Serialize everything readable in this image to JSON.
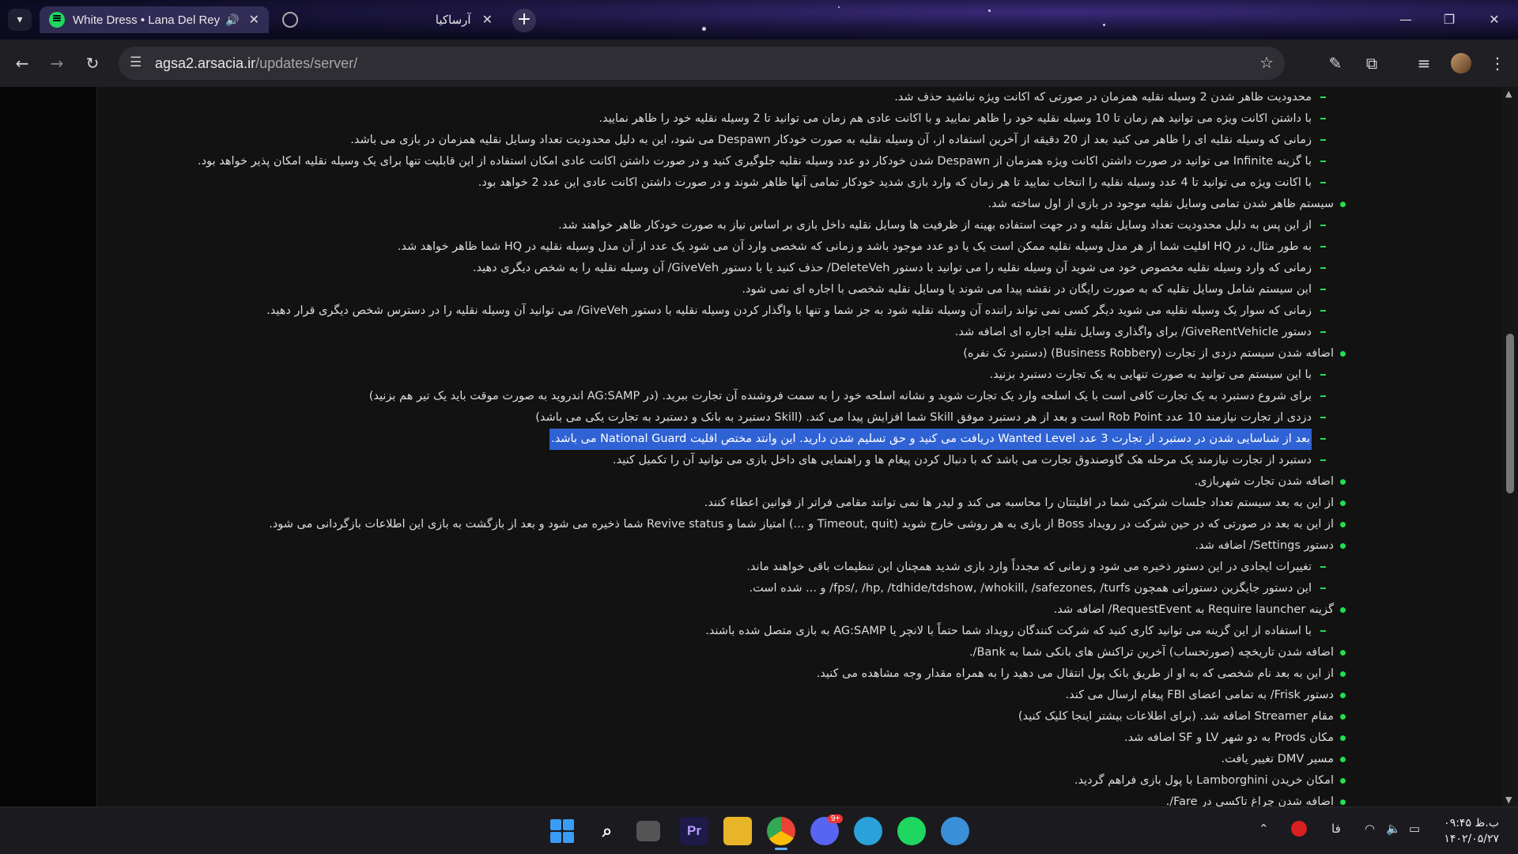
{
  "browser": {
    "tabs": [
      {
        "title": "White Dress • Lana Del Rey",
        "favicon": "spotify-icon",
        "audio": true
      },
      {
        "title": "آرساکیا",
        "favicon": "globe-icon",
        "audio": false
      }
    ],
    "url_host": "agsa2.arsacia.ir",
    "url_path": "/updates/server/"
  },
  "lines": [
    {
      "level": 1,
      "text": "محدودیت ظاهر شدن 2 وسیله نقلیه همزمان در صورتی که اکانت ویژه نباشید حذف شد."
    },
    {
      "level": 1,
      "text": "با داشتن اکانت ویژه می توانید هم زمان تا 10 وسیله نقلیه خود را ظاهر نمایید و با اکانت عادی هم زمان می توانید تا 2 وسیله نقلیه خود را ظاهر نمایید."
    },
    {
      "level": 1,
      "text": "زمانی که وسیله نقلیه ای را ظاهر می کنید بعد از 20 دقیقه از آخرین استفاده از، آن وسیله نقلیه به صورت خودکار Despawn می شود، این به دلیل محدودیت تعداد وسایل نقلیه همزمان در بازی می باشد."
    },
    {
      "level": 1,
      "text": "با گزینه Infinite می توانید در صورت داشتن اکانت ویژه همزمان از Despawn شدن خودکار دو عدد وسیله نقلیه جلوگیری کنید و در صورت داشتن اکانت عادی امکان استفاده از این قابلیت تنها برای یک وسیله نقلیه امکان پذیر خواهد بود."
    },
    {
      "level": 1,
      "text": "با اکانت ویژه می توانید تا 4 عدد وسیله نقلیه را انتخاب نمایید تا هر زمان که وارد بازی شدید خودکار تمامی آنها ظاهر شوند و در صورت داشتن اکانت عادی این عدد 2 خواهد بود."
    },
    {
      "level": 0,
      "text": "سیستم ظاهر شدن تمامی وسایل نقلیه موجود در بازی از اول ساخته شد."
    },
    {
      "level": 1,
      "text": "از این پس به دلیل محدودیت تعداد وسایل نقلیه و در جهت استفاده بهینه از ظرفیت ها وسایل نقلیه داخل بازی بر اساس نیاز به صورت خودکار ظاهر خواهند شد."
    },
    {
      "level": 1,
      "text": "به طور مثال، در HQ اقلیت شما از هر مدل وسیله نقلیه ممکن است یک یا دو عدد موجود باشد و زمانی که شخصی وارد آن می شود یک عدد از آن مدل وسیله نقلیه در HQ شما ظاهر خواهد شد."
    },
    {
      "level": 1,
      "text": "زمانی که وارد وسیله نقلیه مخصوص خود می شوید آن وسیله نقلیه را می توانید با دستور DeleteVeh/ حذف کنید یا با دستور GiveVeh/ آن وسیله نقلیه را به شخص دیگری دهید."
    },
    {
      "level": 1,
      "text": "این سیستم شامل وسایل نقلیه که به صورت رایگان در نقشه پیدا می شوند یا وسایل نقلیه شخصی با اجاره ای نمی شود."
    },
    {
      "level": 1,
      "text": "زمانی که سوار یک وسیله نقلیه می شوید دیگر کسی نمی تواند راننده آن وسیله نقلیه شود به جز شما و تنها با واگذار کردن وسیله نقلیه با دستور GiveVeh/ می توانید آن وسیله نقلیه را در دسترس شخص دیگری قرار دهید."
    },
    {
      "level": 1,
      "text": "دستور GiveRentVehicle/ برای واگذاری وسایل نقلیه اجاره ای اضافه شد."
    },
    {
      "level": 0,
      "text": "اضافه شدن سیستم دزدی از تجارت (Business Robbery) (دستبرد تک نفره)"
    },
    {
      "level": 1,
      "text": "با این سیستم می توانید به صورت تنهایی به یک تجارت دستبرد بزنید."
    },
    {
      "level": 1,
      "text": "برای شروع دستبرد به یک تجارت کافی است با یک اسلحه وارد یک تجارت شوید و نشانه اسلحه خود را به سمت فروشنده آن تجارت ببرید. (در AG:SAMP اندروید به صورت موقت باید یک تیر هم بزنید)"
    },
    {
      "level": 1,
      "text": "دزدی از تجارت نیازمند 10 عدد Rob Point است و بعد از هر دستبرد موفق Skill شما افزایش پیدا می کند. (Skill دستبرد به بانک و دستبرد به تجارت یکی می باشد)"
    },
    {
      "level": 1,
      "text": "بعد از شناسایی شدن در دستبرد از تجارت 3 عدد Wanted Level دریافت می کنید و حق تسلیم شدن دارید. این وانتد مختص اقلیت National Guard می باشد.",
      "highlighted": true
    },
    {
      "level": 1,
      "text": "دستبرد از تجارت نیازمند یک مرحله هک گاوصندوق تجارت می باشد که با دنبال کردن پیغام ها و راهنمایی های داخل بازی می توانید آن را تکمیل کنید."
    },
    {
      "level": 0,
      "text": "اضافه شدن تجارت شهربازی."
    },
    {
      "level": 0,
      "text": "از این به بعد سیستم تعداد جلسات شرکتی شما در اقلیتتان را محاسبه می کند و لیدر ها نمی توانند مقامی فراتر از قوانین اعطاء کنند."
    },
    {
      "level": 0,
      "text": "از این به بعد در صورتی که در حین شرکت در رویداد Boss از بازی به هر روشی خارج شوید (Timeout, quit و ...) امتیاز شما و Revive status شما ذخیره می شود و بعد از بازگشت به بازی این اطلاعات بازگردانی می شود."
    },
    {
      "level": 0,
      "text": "دستور Settings/ اضافه شد."
    },
    {
      "level": 1,
      "text": "تغییرات ایجادی در این دستور ذخیره می شود و زمانی که مجدداً وارد بازی شدید همچنان این تنظیمات باقی خواهند ماند."
    },
    {
      "level": 1,
      "text": "این دستور جایگزین دستوراتی همچون fps/, /hp, /tdhide/tdshow, /whokill, /safezones, /turfs/ و ... شده است."
    },
    {
      "level": 0,
      "text": "گزینه Require launcher به RequestEvent/ اضافه شد."
    },
    {
      "level": 1,
      "text": "با استفاده از این گزینه می توانید کاری کنید که شرکت کنندگان رویداد شما حتماً با لانچر یا AG:SAMP به بازی متصل شده باشند."
    },
    {
      "level": 0,
      "text": "اضافه شدن تاریخچه (صورتحساب) آخرین تراکنش های بانکی شما به Bank/."
    },
    {
      "level": 0,
      "text": "از این به بعد نام شخصی که به او از طریق بانک پول انتقال می دهید را به همراه مقدار وجه مشاهده می کنید."
    },
    {
      "level": 0,
      "text": "دستور Frisk/ به تمامی اعضای FBI پیغام ارسال می کند."
    },
    {
      "level": 0,
      "text": "مقام Streamer اضافه شد. (برای اطلاعات بیشتر اینجا کلیک کنید)"
    },
    {
      "level": 0,
      "text": "مکان Prods به دو شهر LV و SF اضافه شد."
    },
    {
      "level": 0,
      "text": "مسیر DMV تغییر یافت."
    },
    {
      "level": 0,
      "text": "امکان خریدن Lamborghini با پول بازی فراهم گردید."
    },
    {
      "level": 0,
      "text": "اضافه شدن چراغ تاکسی در Fare/."
    }
  ],
  "scroll": {
    "position_fraction": 0.42
  },
  "taskbar": {
    "discord_badge": "9+",
    "keyboard_lang": "فا",
    "clock_time": "۰۹:۴۵ ب.ظ",
    "clock_date": "۱۴۰۲/۰۵/۲۷"
  },
  "colors": {
    "accent_green": "#22e04a",
    "selection": "#2f62d4"
  }
}
